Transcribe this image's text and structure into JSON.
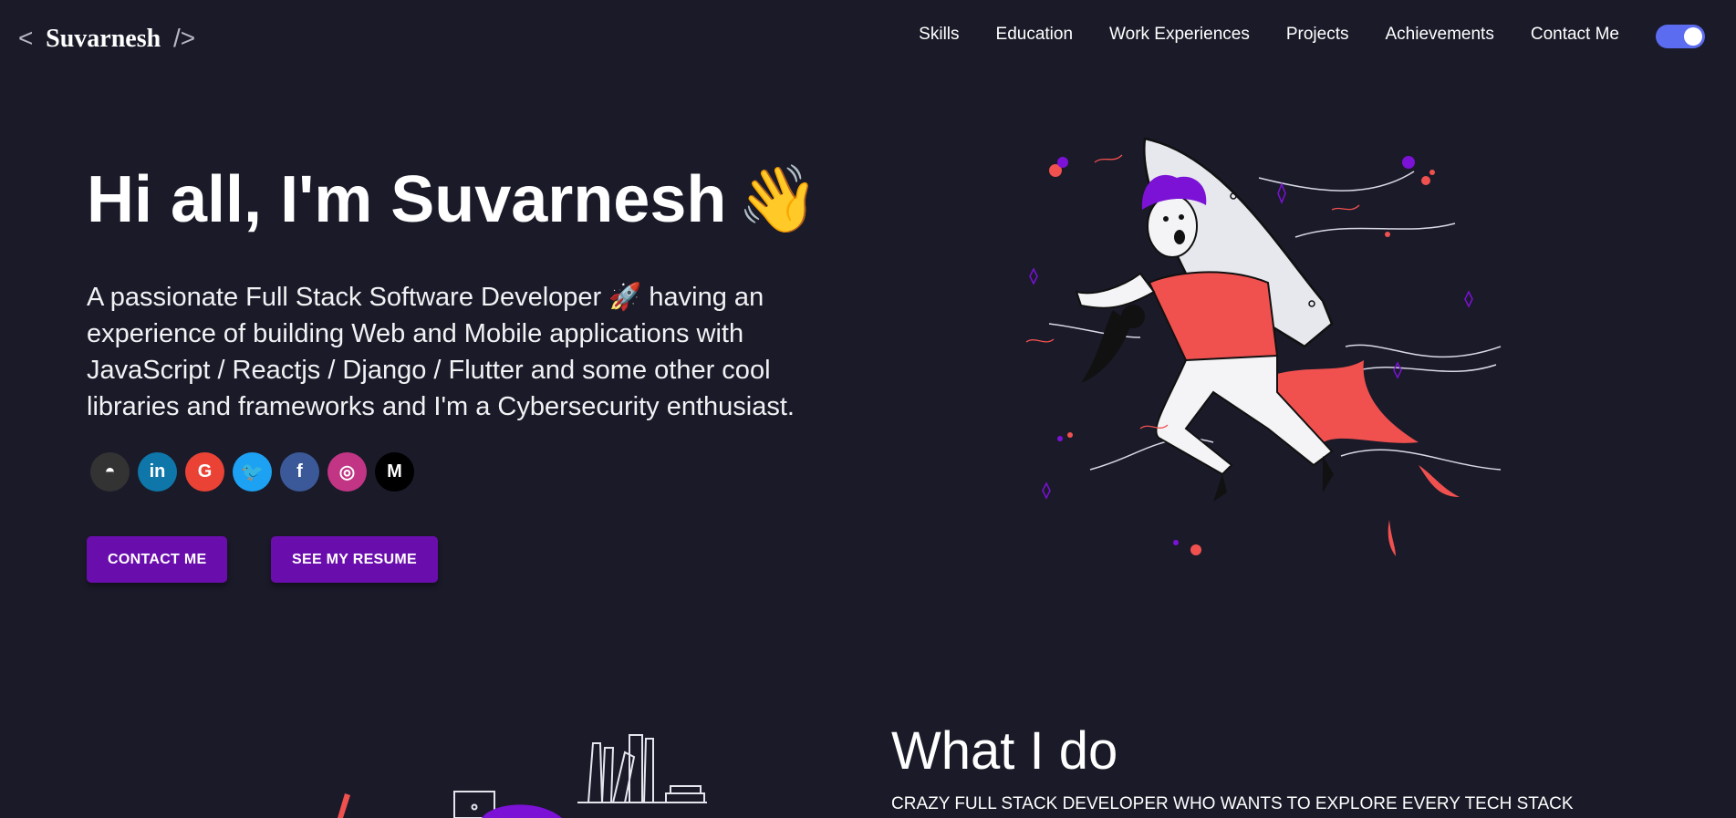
{
  "header": {
    "logo_open": "<",
    "logo_name": "Suvarnesh",
    "logo_close": "/>",
    "nav": [
      "Skills",
      "Education",
      "Work Experiences",
      "Projects",
      "Achievements",
      "Contact Me"
    ],
    "theme_toggle": "on"
  },
  "hero": {
    "title": "Hi all, I'm Suvarnesh",
    "wave_emoji": "👋",
    "subtitle_part1": "A passionate Full Stack Software Developer",
    "rocket_emoji": "🚀",
    "subtitle_part2": "having an experience of building Web and Mobile applications with JavaScript / Reactjs / Django / Flutter and some other cool libraries and frameworks and I'm a Cybersecurity enthusiast.",
    "socials": [
      {
        "name": "github-icon",
        "glyph": "◓",
        "color": "#333333"
      },
      {
        "name": "linkedin-icon",
        "glyph": "in",
        "color": "#0e76a8"
      },
      {
        "name": "google-icon",
        "glyph": "G",
        "color": "#ea4335"
      },
      {
        "name": "twitter-icon",
        "glyph": "🐦",
        "color": "#1da1f2"
      },
      {
        "name": "facebook-icon",
        "glyph": "f",
        "color": "#3b5998"
      },
      {
        "name": "instagram-icon",
        "glyph": "◎",
        "color": "#c13584"
      },
      {
        "name": "medium-icon",
        "glyph": "M",
        "color": "#000000"
      }
    ],
    "contact_button": "CONTACT ME",
    "resume_button": "SEE MY RESUME"
  },
  "what_i_do": {
    "title": "What I do",
    "subtitle": "CRAZY FULL STACK DEVELOPER WHO WANTS TO EXPLORE EVERY TECH STACK"
  },
  "colors": {
    "background": "#1a1a29",
    "button": "#6a0dad",
    "accent_red": "#f0514f",
    "accent_purple": "#7b12d6",
    "toggle": "#5b6cf0"
  }
}
